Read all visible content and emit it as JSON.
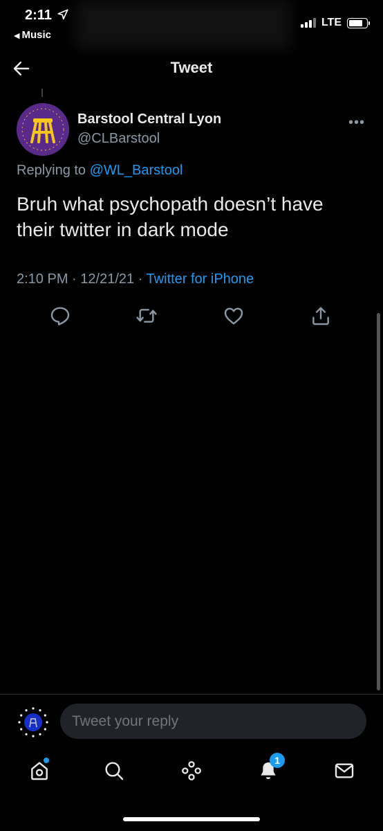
{
  "status_bar": {
    "time": "2:11",
    "back_app": "Music",
    "network": "LTE"
  },
  "header": {
    "title": "Tweet"
  },
  "tweet": {
    "display_name": "Barstool Central Lyon",
    "handle": "@CLBarstool",
    "replying_prefix": "Replying to ",
    "replying_to": "@WL_Barstool",
    "text": "Bruh what psychopath doesn’t have their twitter in dark mode",
    "time": "2:10 PM",
    "date": "12/21/21",
    "source": "Twitter for iPhone",
    "more_glyph": "•••"
  },
  "reply": {
    "placeholder": "Tweet your reply"
  },
  "tab_bar": {
    "notification_count": "1"
  },
  "colors": {
    "accent": "#1d9bf0",
    "background": "#000000",
    "text_primary": "#e7e9ea",
    "text_secondary": "#8b98a5",
    "avatar_purple": "#5a2a8a",
    "avatar_gold": "#f5c518"
  },
  "icons": {
    "back": "arrow-left-icon",
    "reply": "comment-icon",
    "retweet": "retweet-icon",
    "like": "heart-icon",
    "share": "share-icon",
    "home": "home-icon",
    "search": "search-icon",
    "spaces": "spaces-icon",
    "notifications": "bell-icon",
    "messages": "mail-icon"
  }
}
